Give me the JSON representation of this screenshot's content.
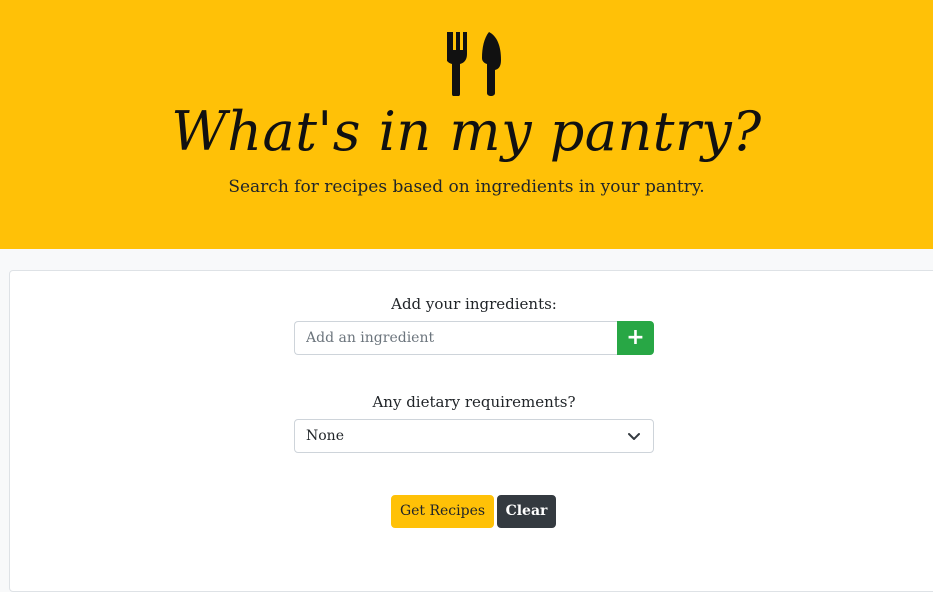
{
  "header": {
    "title": "What's in my pantry?",
    "subtitle": "Search for recipes based on ingredients in your pantry.",
    "logo_icon": "fork-knife-icon",
    "background_color": "#ffc107"
  },
  "form": {
    "ingredients_label": "Add your ingredients:",
    "ingredient_placeholder": "Add an ingredient",
    "ingredient_value": "",
    "add_button_label": "+",
    "add_button_color": "#28a745",
    "dietary_label": "Any dietary requirements?",
    "dietary_selected": "None"
  },
  "actions": {
    "get_recipes_label": "Get Recipes",
    "clear_label": "Clear"
  }
}
